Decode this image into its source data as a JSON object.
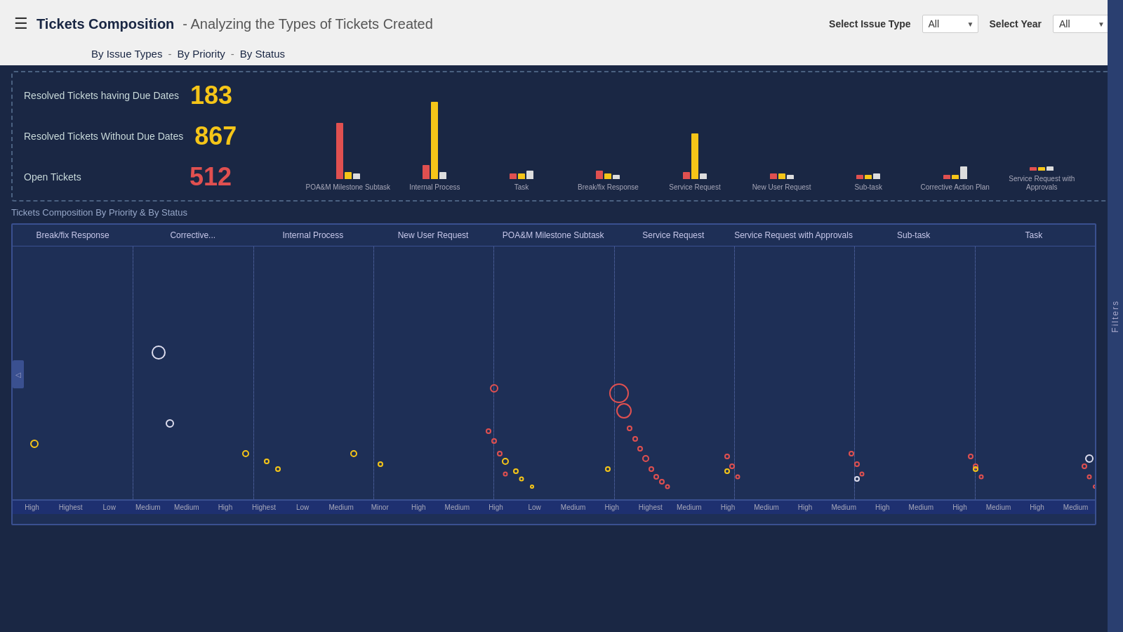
{
  "header": {
    "title": "Tickets Composition",
    "subtitle": "- Analyzing the Types of Tickets Created",
    "hamburger_icon": "☰",
    "filters": {
      "issue_type_label": "Select Issue Type",
      "issue_type_value": "All",
      "year_label": "Select Year",
      "year_value": "All"
    }
  },
  "nav": {
    "tabs": [
      {
        "label": "By Issue Types",
        "id": "by-issue-types"
      },
      {
        "sep": "-"
      },
      {
        "label": "By Priority",
        "id": "by-priority"
      },
      {
        "sep": "-"
      },
      {
        "label": "By Status",
        "id": "by-status"
      }
    ]
  },
  "stats": {
    "rows": [
      {
        "label": "Resolved Tickets having Due Dates",
        "value": "183",
        "color": "yellow"
      },
      {
        "label": "Resolved Tickets Without Due Dates",
        "value": "867",
        "color": "yellow"
      },
      {
        "label": "Open Tickets",
        "value": "512",
        "color": "red"
      }
    ]
  },
  "bar_chart": {
    "groups": [
      {
        "label": "POA&M Milestone\nSubtask",
        "bars": [
          {
            "color": "red",
            "height": 80
          },
          {
            "color": "yellow",
            "height": 10
          },
          {
            "color": "white",
            "height": 8
          }
        ]
      },
      {
        "label": "Internal Process",
        "bars": [
          {
            "color": "red",
            "height": 20
          },
          {
            "color": "yellow",
            "height": 110
          },
          {
            "color": "white",
            "height": 10
          }
        ]
      },
      {
        "label": "Task",
        "bars": [
          {
            "color": "red",
            "height": 8
          },
          {
            "color": "yellow",
            "height": 8
          },
          {
            "color": "white",
            "height": 12
          }
        ]
      },
      {
        "label": "Break/fix Response",
        "bars": [
          {
            "color": "red",
            "height": 12
          },
          {
            "color": "yellow",
            "height": 8
          },
          {
            "color": "white",
            "height": 6
          }
        ]
      },
      {
        "label": "Service Request",
        "bars": [
          {
            "color": "red",
            "height": 10
          },
          {
            "color": "yellow",
            "height": 65
          },
          {
            "color": "white",
            "height": 8
          }
        ]
      },
      {
        "label": "New User Request",
        "bars": [
          {
            "color": "red",
            "height": 8
          },
          {
            "color": "yellow",
            "height": 8
          },
          {
            "color": "white",
            "height": 6
          }
        ]
      },
      {
        "label": "Sub-task",
        "bars": [
          {
            "color": "red",
            "height": 6
          },
          {
            "color": "yellow",
            "height": 6
          },
          {
            "color": "white",
            "height": 8
          }
        ]
      },
      {
        "label": "Corrective Action\nPlan",
        "bars": [
          {
            "color": "red",
            "height": 6
          },
          {
            "color": "yellow",
            "height": 6
          },
          {
            "color": "white",
            "height": 18
          }
        ]
      },
      {
        "label": "Service Request\nwith Approvals",
        "bars": [
          {
            "color": "red",
            "height": 5
          },
          {
            "color": "yellow",
            "height": 5
          },
          {
            "color": "white",
            "height": 6
          }
        ]
      }
    ]
  },
  "scatter": {
    "section_title": "Tickets Composition By Priority & By Status",
    "columns": [
      {
        "label": "Break/fix Response",
        "width_pct": 11.1
      },
      {
        "label": "Corrective...",
        "width_pct": 11.1
      },
      {
        "label": "Internal Process",
        "width_pct": 11.1
      },
      {
        "label": "New User Request",
        "width_pct": 11.1
      },
      {
        "label": "POA&M Milestone Subtask",
        "width_pct": 11.1
      },
      {
        "label": "Service Request",
        "width_pct": 11.1
      },
      {
        "label": "Service Request with Approvals",
        "width_pct": 11.1
      },
      {
        "label": "Sub-task",
        "width_pct": 11.1
      },
      {
        "label": "Task",
        "width_pct": 11.1
      }
    ],
    "dots": [
      {
        "col_pct": 2.0,
        "y_pct": 78,
        "size": 12,
        "color": "yellow"
      },
      {
        "col_pct": 13.5,
        "y_pct": 42,
        "size": 20,
        "color": "white"
      },
      {
        "col_pct": 14.5,
        "y_pct": 70,
        "size": 12,
        "color": "white"
      },
      {
        "col_pct": 21.5,
        "y_pct": 82,
        "size": 10,
        "color": "yellow"
      },
      {
        "col_pct": 23.5,
        "y_pct": 85,
        "size": 8,
        "color": "yellow"
      },
      {
        "col_pct": 24.5,
        "y_pct": 88,
        "size": 8,
        "color": "yellow"
      },
      {
        "col_pct": 31.5,
        "y_pct": 82,
        "size": 10,
        "color": "yellow"
      },
      {
        "col_pct": 34.0,
        "y_pct": 86,
        "size": 8,
        "color": "yellow"
      },
      {
        "col_pct": 45.5,
        "y_pct": 85,
        "size": 10,
        "color": "yellow"
      },
      {
        "col_pct": 46.5,
        "y_pct": 89,
        "size": 8,
        "color": "yellow"
      },
      {
        "col_pct": 47.0,
        "y_pct": 92,
        "size": 7,
        "color": "yellow"
      },
      {
        "col_pct": 48.0,
        "y_pct": 95,
        "size": 6,
        "color": "yellow"
      },
      {
        "col_pct": 56.0,
        "y_pct": 58,
        "size": 28,
        "color": "red"
      },
      {
        "col_pct": 56.5,
        "y_pct": 65,
        "size": 22,
        "color": "red"
      },
      {
        "col_pct": 57.0,
        "y_pct": 72,
        "size": 8,
        "color": "red"
      },
      {
        "col_pct": 57.5,
        "y_pct": 76,
        "size": 8,
        "color": "red"
      },
      {
        "col_pct": 58.0,
        "y_pct": 80,
        "size": 8,
        "color": "red"
      },
      {
        "col_pct": 58.5,
        "y_pct": 84,
        "size": 10,
        "color": "red"
      },
      {
        "col_pct": 59.0,
        "y_pct": 88,
        "size": 8,
        "color": "red"
      },
      {
        "col_pct": 59.5,
        "y_pct": 91,
        "size": 8,
        "color": "red"
      },
      {
        "col_pct": 60.0,
        "y_pct": 93,
        "size": 8,
        "color": "red"
      },
      {
        "col_pct": 60.5,
        "y_pct": 95,
        "size": 7,
        "color": "red"
      },
      {
        "col_pct": 44.5,
        "y_pct": 56,
        "size": 12,
        "color": "red"
      },
      {
        "col_pct": 44.0,
        "y_pct": 73,
        "size": 8,
        "color": "red"
      },
      {
        "col_pct": 44.5,
        "y_pct": 77,
        "size": 8,
        "color": "red"
      },
      {
        "col_pct": 45.0,
        "y_pct": 82,
        "size": 8,
        "color": "red"
      },
      {
        "col_pct": 45.5,
        "y_pct": 90,
        "size": 7,
        "color": "red"
      },
      {
        "col_pct": 66.0,
        "y_pct": 83,
        "size": 8,
        "color": "red"
      },
      {
        "col_pct": 66.5,
        "y_pct": 87,
        "size": 8,
        "color": "red"
      },
      {
        "col_pct": 67.0,
        "y_pct": 91,
        "size": 7,
        "color": "red"
      },
      {
        "col_pct": 77.5,
        "y_pct": 82,
        "size": 8,
        "color": "red"
      },
      {
        "col_pct": 78.0,
        "y_pct": 86,
        "size": 8,
        "color": "red"
      },
      {
        "col_pct": 78.5,
        "y_pct": 90,
        "size": 7,
        "color": "red"
      },
      {
        "col_pct": 88.5,
        "y_pct": 83,
        "size": 8,
        "color": "red"
      },
      {
        "col_pct": 89.0,
        "y_pct": 87,
        "size": 8,
        "color": "red"
      },
      {
        "col_pct": 89.5,
        "y_pct": 91,
        "size": 7,
        "color": "red"
      },
      {
        "col_pct": 99.0,
        "y_pct": 87,
        "size": 8,
        "color": "red"
      },
      {
        "col_pct": 99.5,
        "y_pct": 91,
        "size": 7,
        "color": "red"
      },
      {
        "col_pct": 100.0,
        "y_pct": 95,
        "size": 6,
        "color": "red"
      },
      {
        "col_pct": 55.0,
        "y_pct": 88,
        "size": 8,
        "color": "yellow"
      },
      {
        "col_pct": 66.0,
        "y_pct": 89,
        "size": 8,
        "color": "yellow"
      },
      {
        "col_pct": 89.0,
        "y_pct": 88,
        "size": 8,
        "color": "yellow"
      },
      {
        "col_pct": 78.0,
        "y_pct": 92,
        "size": 8,
        "color": "white"
      },
      {
        "col_pct": 99.5,
        "y_pct": 84,
        "size": 12,
        "color": "white"
      }
    ],
    "x_labels": [
      "High",
      "Highest",
      "Low",
      "Medium",
      "Medium",
      "High",
      "Highest",
      "Low",
      "Medium",
      "Minor",
      "High",
      "Medium",
      "High",
      "Low",
      "Medium",
      "High",
      "Highest",
      "Medium",
      "High",
      "Medium",
      "High",
      "Medium",
      "High",
      "Medium",
      "High",
      "Medium",
      "High",
      "Medium"
    ]
  },
  "filters_panel": {
    "label": "Filters"
  }
}
